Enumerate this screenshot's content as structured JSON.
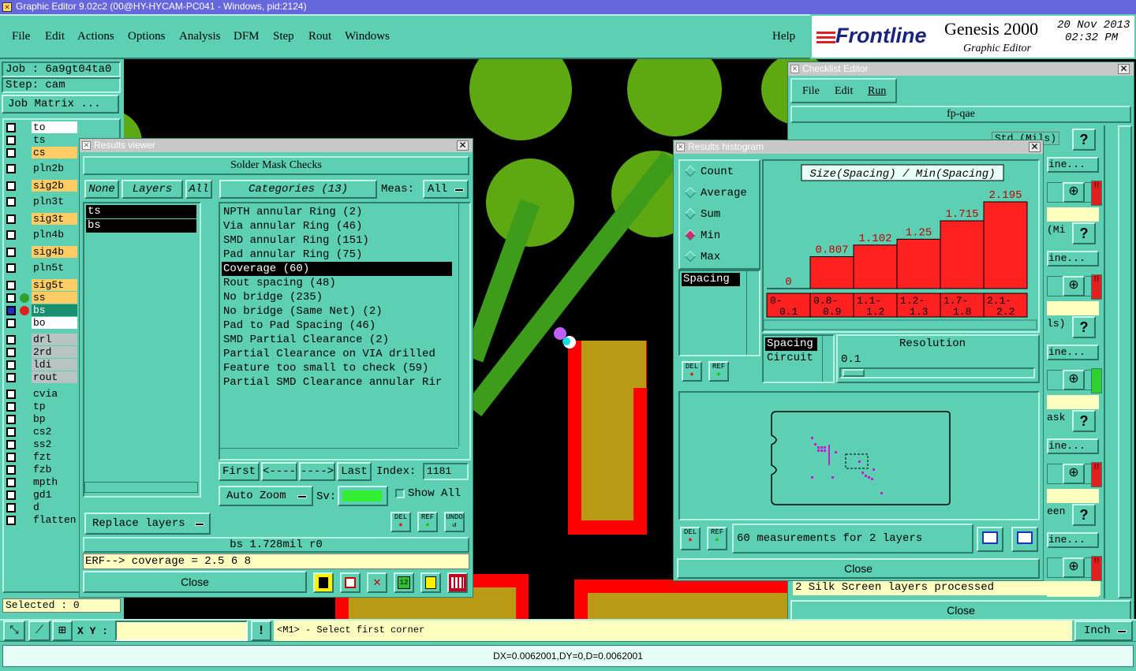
{
  "app_title": "Graphic Editor 9.02c2 (00@HY-HYCAM-PC041 - Windows, pid:2124)",
  "menu": [
    "File",
    "Edit",
    "Actions",
    "Options",
    "Analysis",
    "DFM",
    "Step",
    "Rout",
    "Windows"
  ],
  "help": "Help",
  "brand": {
    "logo": "Frontline",
    "product": "Genesis 2000",
    "subtitle": "Graphic Editor",
    "date": "20 Nov 2013",
    "time": "02:32 PM"
  },
  "job": {
    "job_label": "Job : 6a9gt04ta0",
    "step_label": "Step: cam",
    "matrix_button": "Job Matrix ..."
  },
  "layers": [
    {
      "name": "to",
      "color": "#ffffff"
    },
    {
      "name": "ts",
      "color": "#5dd0b4"
    },
    {
      "name": "cs",
      "color": "#ffcc66"
    },
    {
      "name": "pln2b",
      "color": "#5dd0b4"
    },
    {
      "name": "sig2b",
      "color": "#ffcc66"
    },
    {
      "name": "pln3t",
      "color": "#5dd0b4"
    },
    {
      "name": "sig3t",
      "color": "#ffcc66"
    },
    {
      "name": "pln4b",
      "color": "#5dd0b4"
    },
    {
      "name": "sig4b",
      "color": "#ffcc66"
    },
    {
      "name": "pln5t",
      "color": "#5dd0b4"
    },
    {
      "name": "sig5t",
      "color": "#ffcc66"
    },
    {
      "name": "ss",
      "color": "#ffcc66"
    },
    {
      "name": "bs",
      "color": "#1a8f6f"
    },
    {
      "name": "bo",
      "color": "#ffffff"
    },
    {
      "name": "drl",
      "color": "#b8c4c4"
    },
    {
      "name": "2rd",
      "color": "#b8c4c4"
    },
    {
      "name": "ldi",
      "color": "#b8c4c4"
    },
    {
      "name": "rout",
      "color": "#b8c4c4"
    },
    {
      "name": "cvia",
      "color": "#5dd0b4"
    },
    {
      "name": "tp",
      "color": "#5dd0b4"
    },
    {
      "name": "bp",
      "color": "#5dd0b4"
    },
    {
      "name": "cs2",
      "color": "#5dd0b4"
    },
    {
      "name": "ss2",
      "color": "#5dd0b4"
    },
    {
      "name": "fzt",
      "color": "#5dd0b4"
    },
    {
      "name": "fzb",
      "color": "#5dd0b4"
    },
    {
      "name": "mpth",
      "color": "#5dd0b4"
    },
    {
      "name": "gd1",
      "color": "#5dd0b4"
    },
    {
      "name": "d",
      "color": "#5dd0b4"
    },
    {
      "name": "flatten",
      "color": "#5dd0b4"
    }
  ],
  "selected": "Selected : 0",
  "results_viewer": {
    "title": "Results viewer",
    "header": "Solder Mask Checks",
    "none_btn": "None",
    "layers_btn": "Layers",
    "all_btn": "All",
    "categories_btn": "Categories (13)",
    "meas_label": "Meas:",
    "meas_value": "All",
    "layer_list": [
      "ts",
      "bs"
    ],
    "categories": [
      "NPTH annular Ring (2)",
      "Via annular Ring (46)",
      "SMD annular Ring (151)",
      "Pad annular Ring (75)",
      "Coverage (60)",
      "Rout spacing (48)",
      "No bridge (235)",
      "No bridge (Same Net) (2)",
      "Pad to Pad Spacing (46)",
      "SMD Partial Clearance (2)",
      "Partial Clearance on VIA drilled",
      "Feature too small to check (59)",
      "Partial SMD Clearance annular Rir"
    ],
    "selected_category": "Coverage (60)",
    "nav": {
      "first": "First",
      "prev": "<----",
      "next": "---->",
      "last": "Last",
      "index_label": "Index:",
      "index_value": "1181"
    },
    "auto_zoom": "Auto Zoom",
    "sv_label": "Sv:",
    "show_all": "Show All",
    "replace_layers": "Replace layers",
    "status": "bs 1.728mil  r0",
    "erf": "ERF--> coverage = 2.5 6 8",
    "close": "Close",
    "del": "DEL",
    "ref": "REF",
    "undo": "UNDO"
  },
  "histogram": {
    "title": "Results histogram",
    "options": [
      "Count",
      "Average",
      "Sum",
      "Min",
      "Max"
    ],
    "selected_option": "Min",
    "measure_list": [
      "Spacing"
    ],
    "group_list": [
      "Spacing",
      "Circuit"
    ],
    "resolution_label": "Resolution",
    "resolution_value": "0.1",
    "measurements": "60 measurements for 2 layers",
    "close": "Close",
    "del": "DEL",
    "ref": "REF",
    "chart_data": {
      "type": "bar",
      "title": "Size(Spacing) / Min(Spacing)",
      "categories": [
        "0-0.1",
        "0.8-0.9",
        "1.1-1.2",
        "1.2-1.3",
        "1.7-1.8",
        "2.1-2.2"
      ],
      "values": [
        0,
        0.807,
        1.102,
        1.25,
        1.715,
        2.195
      ],
      "value_labels": [
        "0",
        "0.807",
        "1.102",
        "1.25",
        "1.715",
        "2.195"
      ],
      "ylim": [
        0,
        2.195
      ],
      "bar_color": "#ff2020"
    }
  },
  "checklist": {
    "title": "Checklist Editor",
    "menu": [
      "File",
      "Edit",
      "Run"
    ],
    "name": "fp-qae",
    "std_label": "Std (Mils)",
    "rows": [
      "ine...",
      "ine...",
      "ine...",
      "ine...",
      "ine..."
    ],
    "frag": [
      "(Mi",
      "ls)",
      "ask",
      "een"
    ],
    "status": "2 Silk Screen layers processed",
    "close": "Close",
    "help": "?"
  },
  "bottom": {
    "xy_label": "X Y :",
    "prompt": "<M1> - Select first corner",
    "units": "Inch",
    "measure": "DX=0.0062001,DY=0,D=0.0062001"
  },
  "colors": {
    "panel": "#5dd0b4",
    "board": "#000000",
    "pad": "#5ea812",
    "trace": "#3d9c1a",
    "mask": "#ff0000",
    "gold": "#b99a14",
    "magenta": "#c020d0"
  }
}
